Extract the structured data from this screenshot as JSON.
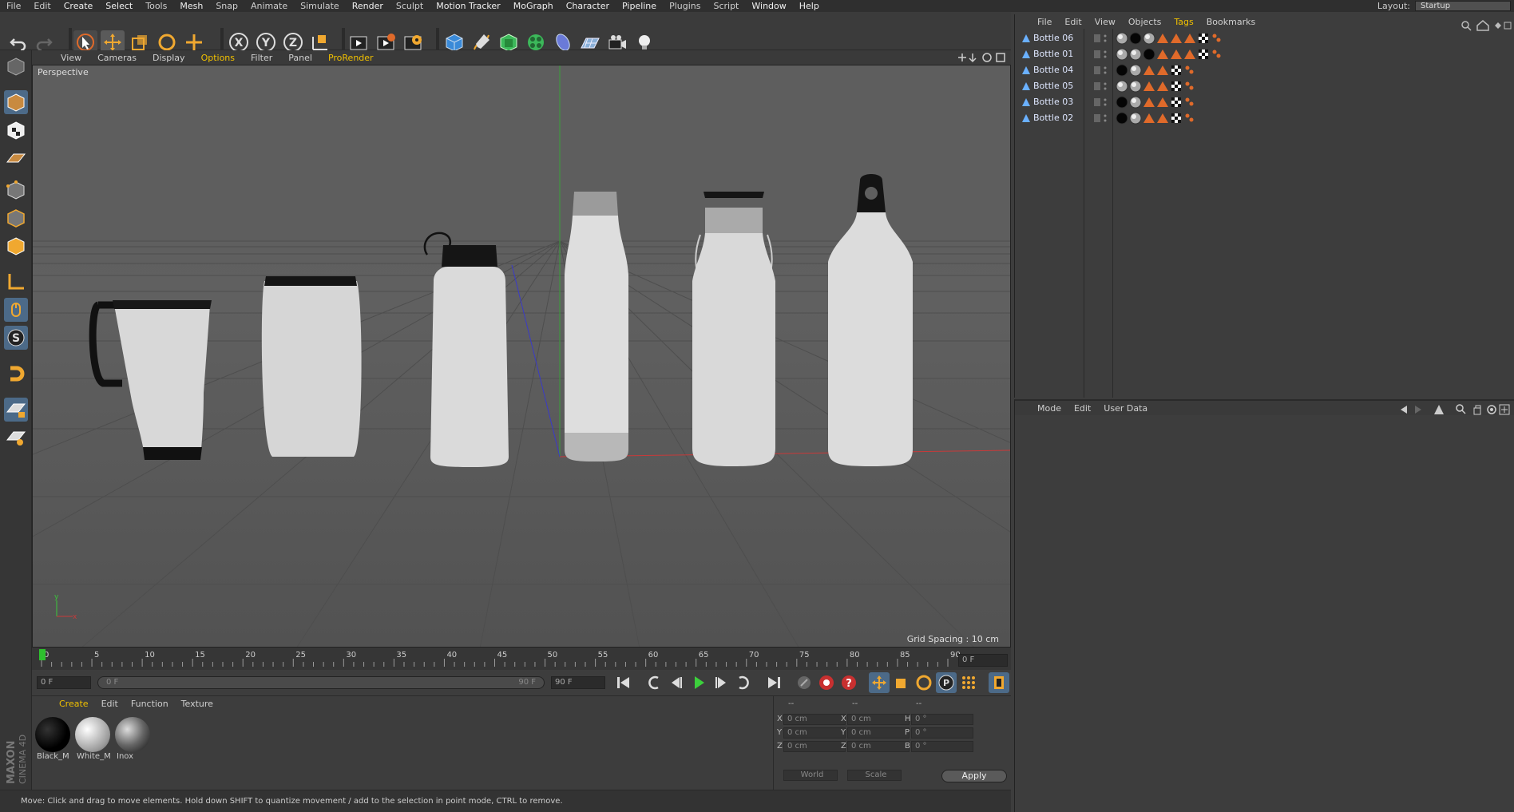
{
  "menubar": {
    "items": [
      "File",
      "Edit",
      "Create",
      "Select",
      "Tools",
      "Mesh",
      "Snap",
      "Animate",
      "Simulate",
      "Render",
      "Sculpt",
      "Motion Tracker",
      "MoGraph",
      "Character",
      "Pipeline",
      "Plugins",
      "Script",
      "Window",
      "Help"
    ],
    "layout_label": "Layout:",
    "layout_value": "Startup"
  },
  "viewport_menu": {
    "items": [
      "View",
      "Cameras",
      "Display",
      "Options",
      "Filter",
      "Panel",
      "ProRender"
    ]
  },
  "viewport": {
    "camera_label": "Perspective",
    "grid_spacing": "Grid Spacing : 10 cm"
  },
  "timeline": {
    "ticks": [
      "0",
      "5",
      "10",
      "15",
      "20",
      "25",
      "30",
      "35",
      "40",
      "45",
      "50",
      "55",
      "60",
      "65",
      "70",
      "75",
      "80",
      "85",
      "90"
    ],
    "current_frame": "0 F"
  },
  "transport": {
    "start_field": "0 F",
    "slider_left": "0 F",
    "slider_right": "90 F",
    "end_field": "90 F"
  },
  "material_panel": {
    "menu": [
      "Create",
      "Edit",
      "Function",
      "Texture"
    ],
    "materials": [
      {
        "label": "Black_M",
        "color": "#050505"
      },
      {
        "label": "White_M",
        "color": "#d8d8d8"
      },
      {
        "label": "Inox",
        "color": "#8a8a8a"
      }
    ]
  },
  "coords": {
    "header_dashes": [
      "--",
      "--",
      "--"
    ],
    "rows": [
      {
        "a": "X",
        "a_val": "0 cm",
        "b": "X",
        "b_val": "0 cm",
        "c": "H",
        "c_val": "0 °"
      },
      {
        "a": "Y",
        "a_val": "0 cm",
        "b": "Y",
        "b_val": "0 cm",
        "c": "P",
        "c_val": "0 °"
      },
      {
        "a": "Z",
        "a_val": "0 cm",
        "b": "Z",
        "b_val": "0 cm",
        "c": "B",
        "c_val": "0 °"
      }
    ],
    "world_select": "World",
    "scale_select": "Scale",
    "apply_label": "Apply"
  },
  "status_text": "Move: Click and drag to move elements. Hold down SHIFT to quantize movement / add to the selection in point mode, CTRL to remove.",
  "logo": {
    "brand": "MAXON",
    "product": "CINEMA 4D"
  },
  "object_manager": {
    "menu": [
      "File",
      "Edit",
      "View",
      "Objects",
      "Tags",
      "Bookmarks"
    ],
    "objects": [
      {
        "name": "Bottle 06",
        "tags": [
          "grey",
          "black",
          "grey",
          "tri",
          "tri",
          "tri",
          "checker",
          "dots"
        ]
      },
      {
        "name": "Bottle 01",
        "tags": [
          "grey",
          "grey",
          "black",
          "tri",
          "tri",
          "tri",
          "checker",
          "dots"
        ]
      },
      {
        "name": "Bottle 04",
        "tags": [
          "black",
          "grey",
          "tri",
          "tri",
          "checker",
          "dots"
        ]
      },
      {
        "name": "Bottle 05",
        "tags": [
          "grey",
          "grey",
          "tri",
          "tri",
          "checker",
          "dots"
        ]
      },
      {
        "name": "Bottle 03",
        "tags": [
          "black",
          "grey",
          "tri",
          "tri",
          "checker",
          "dots"
        ]
      },
      {
        "name": "Bottle 02",
        "tags": [
          "black",
          "grey",
          "tri",
          "tri",
          "checker",
          "dots"
        ]
      }
    ]
  },
  "attribute_manager": {
    "menu": [
      "Mode",
      "Edit",
      "User Data"
    ]
  },
  "colors": {
    "accent": "#f0c000",
    "axis_x": "#c83a3a",
    "axis_y": "#3ac83a",
    "axis_z": "#3a3ac8",
    "tag_orange": "#e06a2a"
  }
}
